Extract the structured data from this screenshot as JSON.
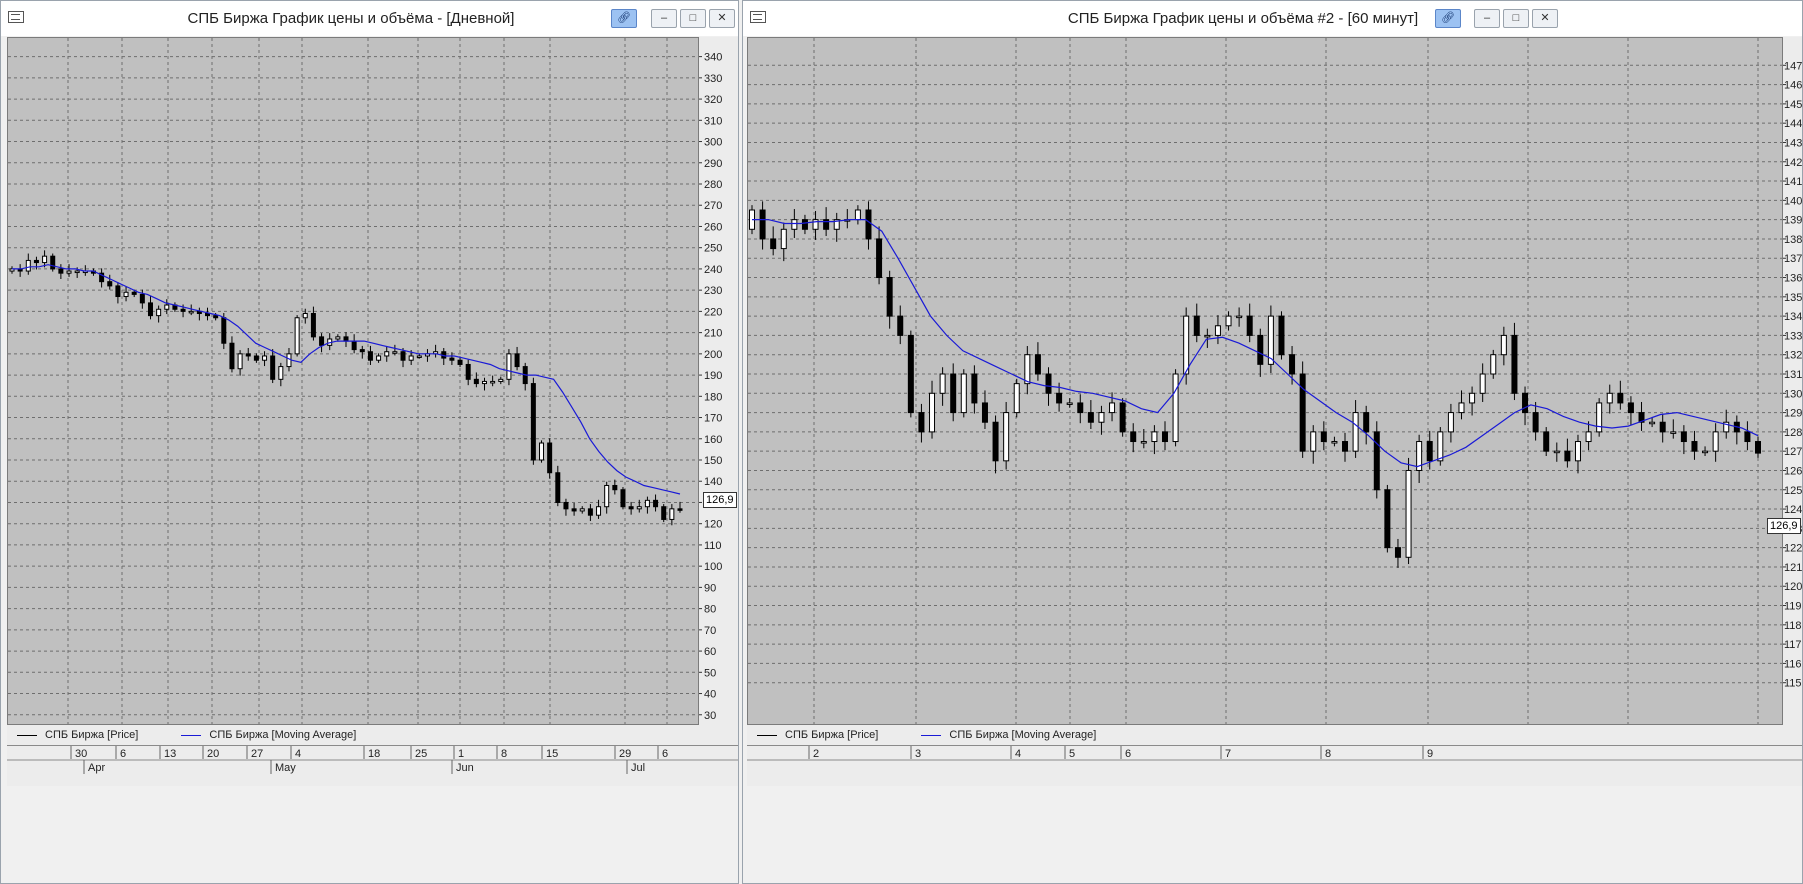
{
  "windows": [
    {
      "title": "СПБ Биржа График цены и объёма - [Дневной]",
      "readout": "126,9",
      "legend": {
        "price": "СПБ Биржа [Price]",
        "ma": "СПБ Биржа [Moving Average]"
      },
      "x_days": [
        "30",
        "6",
        "13",
        "20",
        "27",
        "4",
        "18",
        "25",
        "1",
        "8",
        "15",
        "29",
        "6"
      ],
      "x_months": [
        "Apr",
        "May",
        "Jun",
        "Jul"
      ]
    },
    {
      "title": "СПБ Биржа График цены и объёма #2 - [60 минут]",
      "readout": "126,9",
      "legend": {
        "price": "СПБ Биржа [Price]",
        "ma": "СПБ Биржа [Moving Average]"
      },
      "x_days": [
        "2",
        "3",
        "4",
        "5",
        "6",
        "7",
        "8",
        "9"
      ]
    }
  ],
  "colors": {
    "plot_bg": "#c0c0c0",
    "ma_line": "#1a1ad6",
    "grid": "#6e6e6e",
    "up_candle": "#ffffff",
    "down_candle": "#000000"
  },
  "chart_data": [
    {
      "type": "candlestick",
      "timeframe": "daily",
      "ylim": [
        20,
        345
      ],
      "yticks": [
        30,
        40,
        50,
        60,
        70,
        80,
        90,
        100,
        110,
        120,
        130,
        140,
        150,
        160,
        170,
        180,
        190,
        200,
        210,
        220,
        230,
        240,
        250,
        260,
        270,
        280,
        290,
        300,
        310,
        320,
        330,
        340
      ],
      "last_price": 126.9,
      "close": [
        240,
        239,
        244,
        243,
        246,
        240,
        238,
        239,
        239,
        239,
        238,
        234,
        232,
        227,
        229,
        228,
        224,
        218,
        221,
        223,
        221,
        220,
        220,
        219,
        218,
        217,
        205,
        193,
        200,
        199,
        197,
        199,
        188,
        194,
        200,
        217,
        219,
        208,
        204,
        207,
        208,
        206,
        202,
        201,
        197,
        199,
        201,
        201,
        197,
        199,
        199,
        200,
        201,
        198,
        197,
        195,
        188,
        186,
        187,
        187,
        188,
        200,
        194,
        186,
        150,
        158,
        144,
        130,
        127,
        126,
        127,
        124,
        128,
        138,
        136,
        128,
        127,
        128,
        131,
        128,
        122,
        127,
        126.9
      ],
      "ma_close": [
        240,
        240,
        241,
        241,
        242,
        241,
        240,
        240,
        239,
        239,
        237,
        235,
        233,
        231,
        229,
        228,
        226,
        224,
        223,
        222,
        221,
        220,
        219,
        218,
        216,
        213,
        209,
        205,
        203,
        201,
        199,
        197,
        196,
        200,
        203,
        205,
        206,
        206,
        206,
        206,
        205,
        204,
        203,
        202,
        201,
        200,
        200,
        200,
        199,
        199,
        198,
        197,
        196,
        195,
        193,
        192,
        191,
        190,
        190,
        189,
        188,
        182,
        175,
        168,
        160,
        154,
        149,
        145,
        142,
        140,
        138,
        137,
        136,
        135,
        134
      ],
      "series": [
        {
          "name": "СПБ Биржа [Price]"
        },
        {
          "name": "СПБ Биржа [Moving Average]"
        }
      ]
    },
    {
      "type": "candlestick",
      "timeframe": "60 min",
      "ylim": [
        114,
        148
      ],
      "yticks": [
        115,
        116,
        117,
        118,
        119,
        120,
        121,
        122,
        123,
        124,
        125,
        126,
        127,
        128,
        129,
        130,
        131,
        132,
        133,
        134,
        135,
        136,
        137,
        138,
        139,
        140,
        141,
        142,
        143,
        144,
        145,
        146,
        147
      ],
      "last_price": 126.9,
      "close": [
        139.5,
        138.0,
        137.5,
        138.5,
        139.0,
        138.5,
        139.0,
        138.5,
        139.0,
        139.0,
        139.5,
        138.0,
        136.0,
        134.0,
        133.0,
        129.0,
        128.0,
        130.0,
        131.0,
        129.0,
        131.0,
        129.5,
        128.5,
        126.5,
        129.0,
        130.5,
        132.0,
        131.0,
        130.0,
        129.5,
        129.5,
        129.0,
        128.5,
        129.0,
        129.5,
        128.0,
        127.5,
        127.5,
        128.0,
        127.5,
        131.0,
        134.0,
        133.0,
        133.0,
        133.5,
        134.0,
        134.0,
        133.0,
        131.5,
        134.0,
        132.0,
        131.0,
        127.0,
        128.0,
        127.5,
        127.5,
        127.0,
        129.0,
        128.0,
        125.0,
        122.0,
        121.5,
        126.0,
        127.5,
        126.5,
        128.0,
        129.0,
        129.5,
        130.0,
        131.0,
        132.0,
        133.0,
        130.0,
        129.0,
        128.0,
        127.0,
        127.0,
        126.5,
        127.5,
        128.0,
        129.5,
        130.0,
        129.5,
        129.0,
        128.5,
        128.5,
        128.0,
        128.0,
        127.5,
        127.0,
        127.0,
        128.0,
        128.5,
        128.0,
        127.5,
        126.9
      ],
      "ma_close": [
        139.0,
        139.0,
        138.8,
        138.8,
        138.9,
        138.9,
        139.0,
        139.0,
        138.4,
        137.0,
        135.5,
        134.0,
        133.0,
        132.2,
        131.8,
        131.4,
        131.0,
        130.6,
        130.4,
        130.3,
        130.1,
        130.0,
        129.8,
        129.6,
        129.2,
        129.0,
        130.0,
        131.5,
        132.8,
        132.9,
        132.6,
        132.2,
        131.8,
        131.0,
        130.2,
        129.6,
        129.0,
        128.5,
        127.8,
        127.0,
        126.4,
        126.2,
        126.5,
        126.8,
        127.2,
        127.8,
        128.4,
        129.0,
        129.4,
        129.2,
        128.8,
        128.5,
        128.3,
        128.2,
        128.3,
        128.6,
        128.9,
        129.0,
        128.8,
        128.6,
        128.4,
        128.2,
        127.8
      ],
      "series": [
        {
          "name": "СПБ Биржа [Price]"
        },
        {
          "name": "СПБ Биржа [Moving Average]"
        }
      ]
    }
  ]
}
